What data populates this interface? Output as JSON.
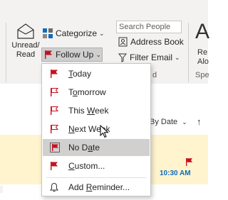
{
  "ribbon": {
    "unread_read_label": "Unread/\nRead",
    "unread_line1": "Unread/",
    "unread_line2": "Read",
    "categorize_label": "Categorize",
    "followup_label": "Follow Up",
    "search_people_placeholder": "Search People",
    "address_book_label": "Address Book",
    "filter_email_label": "Filter Email",
    "big_letter": "A",
    "edge_text_1": "Re",
    "edge_text_2": "Alo",
    "group_label_find": "d",
    "group_label_speech": "Spe"
  },
  "followup_menu": {
    "items": [
      {
        "label": "Today",
        "mnemonic": "T",
        "rest": "oday",
        "flag_color": "#c50f1f"
      },
      {
        "label": "Tomorrow",
        "mnemonic": "o",
        "pre": "T",
        "rest": "morrow",
        "flag_color": "#c50f1f"
      },
      {
        "label": "This Week",
        "pre": "This ",
        "mnemonic": "W",
        "rest": "eek",
        "flag_color": "#c50f1f"
      },
      {
        "label": "Next Week",
        "mnemonic": "N",
        "rest": "ext Week",
        "flag_color": "#c50f1f"
      },
      {
        "label": "No Date",
        "pre": "No D",
        "mnemonic": "a",
        "rest": "te",
        "flag_color": "#c50f1f",
        "highlighted": true
      },
      {
        "label": "Custom...",
        "mnemonic": "C",
        "rest": "ustom...",
        "flag_color": "#c50f1f"
      },
      {
        "label": "Add Reminder...",
        "pre": "Add ",
        "mnemonic": "R",
        "rest": "eminder..."
      }
    ]
  },
  "mail_list": {
    "sort_label": "By Date",
    "sort_direction_icon": "arrow-up-icon",
    "selected_item_time": "10:30 AM"
  },
  "colors": {
    "accent": "#0f6cbd",
    "flag_red": "#c50f1f",
    "highlight_yellow": "#fff4ce",
    "menu_hover": "#d2d0ce"
  }
}
